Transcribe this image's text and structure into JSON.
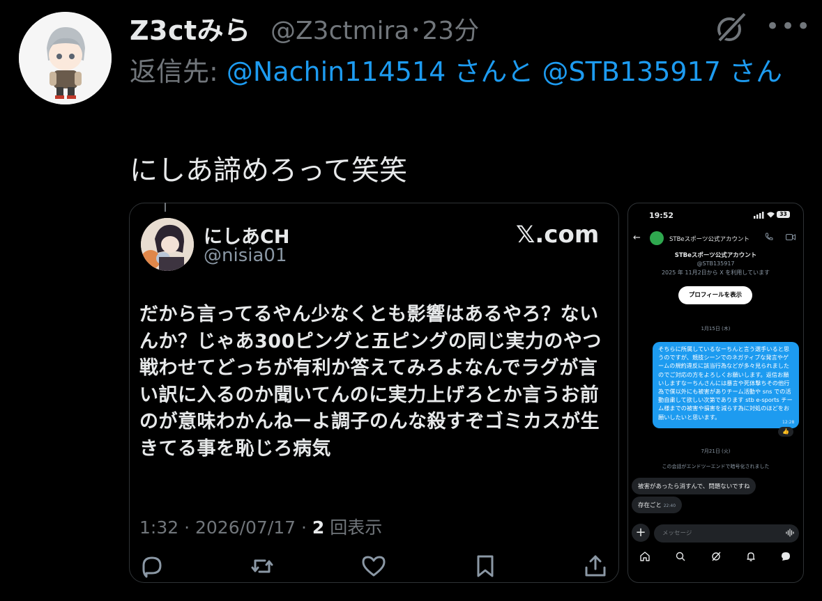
{
  "tweet": {
    "display_name": "Z3ctみら",
    "handle_time": "@Z3ctmira･23分",
    "more_label": "•••",
    "reply_prefix": "返信先: ",
    "reply_mention_1": "@Nachin114514",
    "reply_mid": " さんと ",
    "reply_mention_2": "@STB135917",
    "reply_suffix": " さん",
    "text": "にしあ諦めろって笑笑"
  },
  "quote": {
    "display_name": "にしあCH",
    "handle": "@nisia01",
    "source": "𝕏.com",
    "body": "だから言ってるやん少なくとも影響はあるやろ？ないんか？じゃあ300ピングと五ピングの同じ実力のやつ戦わせてどっちが有利か答えてみろよなんでラグが言い訳に入るのか聞いてんのに実力上げろとか言うお前のが意味わかんねーよ調子のんな殺すぞゴミカスが生きてる事を恥じろ病気",
    "meta_time": "1:32 · 2026/07/17 · ",
    "meta_views_count": "2",
    "meta_views_label": " 回表示"
  },
  "phone": {
    "status_time": "19:52",
    "battery": "33",
    "chat_title": "STBeスポーツ公式アカウント",
    "profile_name": "STBeスポーツ公式アカウント",
    "profile_handle": "@STB135917",
    "profile_joined": "2025 年 11月2日から X を利用しています",
    "profile_button": "プロフィールを表示",
    "date_1": "1月15日 (木)",
    "message_1": "そちらに所属しているなーちんと言う選手いると思うのですが、競技シーンでのネガティブな発言やゲームの規約違反に該当行為などが多々見られましたのでご対応の方をよろしくお願いします。返信お願いしますなーちんさんには暴言や死体撃ちその他行為で僕以外にも被害がありチーム活動や sns での活動自粛して欲しい次第であります stb e-sports チーム様までの被害や損害を減らす為に対処のほどをお願いしたいと思います。",
    "message_1_time": "12:28",
    "reaction": "👍",
    "date_2": "7月21日 (火)",
    "encryption_notice": "この会話がエンドツーエンドで暗号化されました",
    "reply_1": "被害があったら消すんで、問題ないですね",
    "reply_2": "存在ごと",
    "reply_2_time": "22:40",
    "input_placeholder": "メッセージ"
  },
  "colors": {
    "background": "#000000",
    "text": "#e7e9ea",
    "secondary": "#71767b",
    "accent": "#1d9bf0",
    "border": "#2f3336"
  }
}
